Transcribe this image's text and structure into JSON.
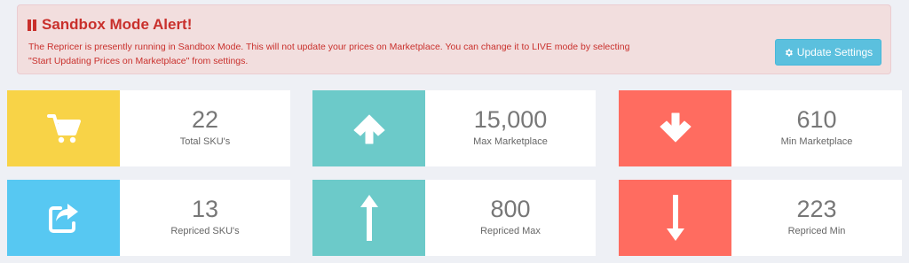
{
  "alert": {
    "title": "Sandbox Mode Alert!",
    "line1": "The Repricer is presently running in Sandbox Mode. This will not update your prices on Marketplace. You can change it to LIVE mode by selecting",
    "line2": "\"Start Updating Prices on Marketplace\" from settings.",
    "button_label": "Update Settings",
    "icon": "pause-icon",
    "button_icon": "gear-icon"
  },
  "cards": [
    {
      "value": "22",
      "label": "Total SKU's",
      "icon": "shopping-cart-icon",
      "color": "#f8d347"
    },
    {
      "value": "15,000",
      "label": "Max Marketplace",
      "icon": "arrow-up-circle-icon",
      "color": "#6ccac9"
    },
    {
      "value": "610",
      "label": "Min Marketplace",
      "icon": "arrow-down-circle-icon",
      "color": "#ff6c60"
    },
    {
      "value": "13",
      "label": "Repriced SKU's",
      "icon": "share-square-icon",
      "color": "#57c8f2"
    },
    {
      "value": "800",
      "label": "Repriced Max",
      "icon": "long-arrow-up-icon",
      "color": "#6ccac9"
    },
    {
      "value": "223",
      "label": "Repriced Min",
      "icon": "long-arrow-down-icon",
      "color": "#ff6c60"
    }
  ],
  "colors": {
    "alert_bg": "#f2dede",
    "alert_text": "#c9302c",
    "info_button": "#5bc0de",
    "page_bg": "#eef0f5"
  }
}
